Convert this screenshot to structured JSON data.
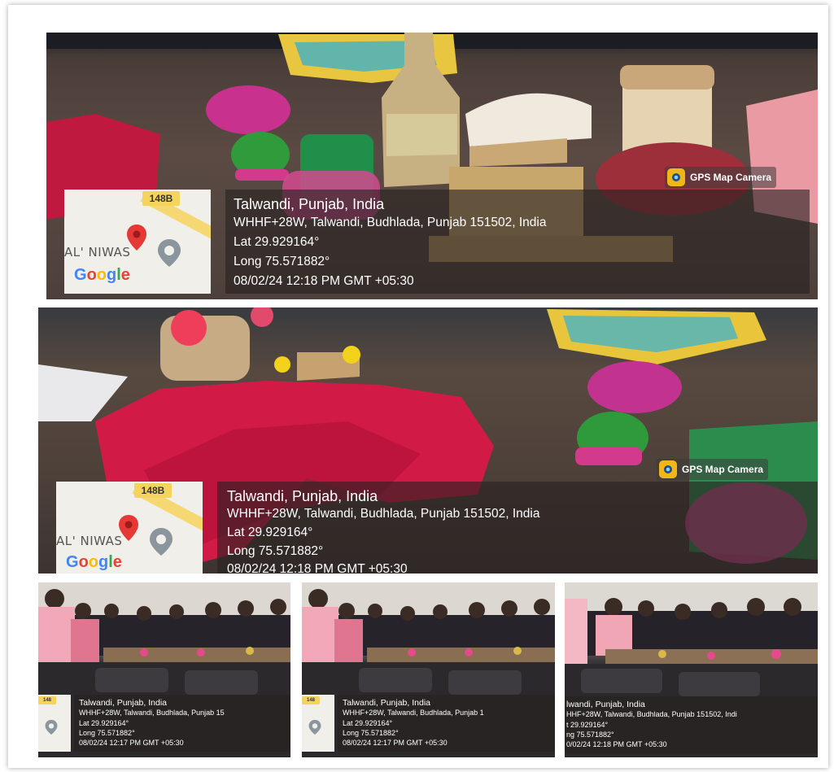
{
  "overlay_label": "GPS Map Camera",
  "map": {
    "road_number": "148B",
    "place_label": "AL' NIWAS",
    "brand": [
      "G",
      "o",
      "o",
      "g",
      "l",
      "e"
    ]
  },
  "photos": [
    {
      "location_title": "Talwandi, Punjab, India",
      "address": "WHHF+28W, Talwandi, Budhlada, Punjab 151502, India",
      "latitude": "Lat 29.929164°",
      "longitude": "Long 75.571882°",
      "timestamp": "08/02/24 12:18 PM GMT +05:30"
    },
    {
      "location_title": "Talwandi, Punjab, India",
      "address": "WHHF+28W, Talwandi, Budhlada, Punjab 151502, India",
      "latitude": "Lat 29.929164°",
      "longitude": "Long 75.571882°",
      "timestamp": "08/02/24 12:18 PM GMT +05:30"
    },
    {
      "location_title": "Talwandi, Punjab, India",
      "address": "WHHF+28W, Talwandi, Budhlada, Punjab 15",
      "latitude": "Lat 29.929164°",
      "longitude": "Long 75.571882°",
      "timestamp": "08/02/24 12:17 PM GMT +05:30"
    },
    {
      "location_title": "Talwandi, Punjab, India",
      "address": "WHHF+28W, Talwandi, Budhlada, Punjab 1",
      "latitude": "Lat 29.929164°",
      "longitude": "Long 75.571882°",
      "timestamp": "08/02/24 12:17 PM GMT +05:30"
    },
    {
      "location_title": "lwandi, Punjab, India",
      "address": "HHF+28W, Talwandi, Budhlada, Punjab 151502, Indi",
      "latitude": "t 29.929164°",
      "longitude": "ng 75.571882°",
      "timestamp": "0/02/24 12:18 PM GMT +05:30"
    }
  ]
}
